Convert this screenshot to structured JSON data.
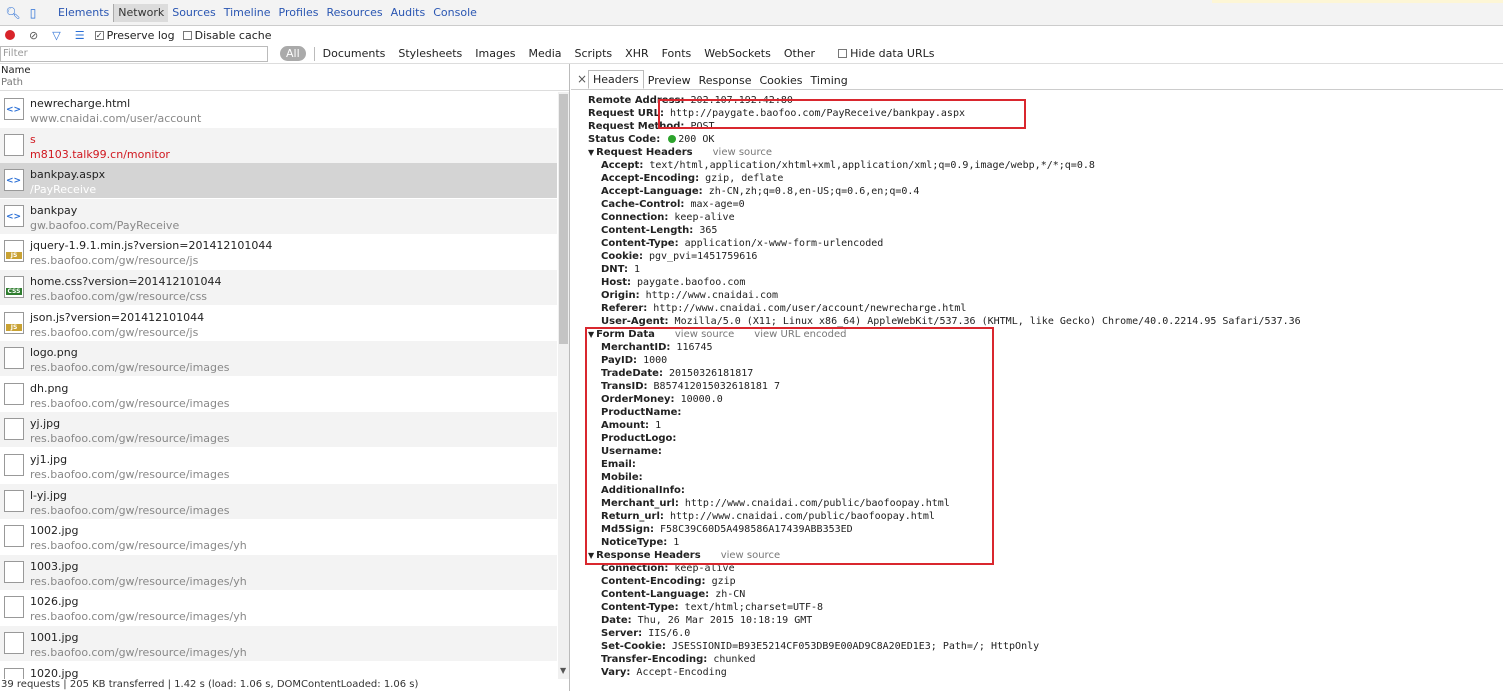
{
  "toolbar": {
    "tabs": [
      "Elements",
      "Network",
      "Sources",
      "Timeline",
      "Profiles",
      "Resources",
      "Audits",
      "Console"
    ]
  },
  "controls": {
    "preserve_log": "Preserve log",
    "disable_cache": "Disable cache"
  },
  "filter": {
    "placeholder": "Filter",
    "all": "All",
    "types": [
      "Documents",
      "Stylesheets",
      "Images",
      "Media",
      "Scripts",
      "XHR",
      "Fonts",
      "WebSockets",
      "Other"
    ],
    "hide_data_urls": "Hide data URLs"
  },
  "list": {
    "header_name": "Name",
    "header_path": "Path",
    "rows": [
      {
        "name": "newrecharge.html",
        "path": "www.cnaidai.com/user/account",
        "icon": "doc-icon"
      },
      {
        "name": "s",
        "path": "m8103.talk99.cn/monitor",
        "icon": "blank-icon"
      },
      {
        "name": "bankpay.aspx",
        "path": "/PayReceive",
        "icon": "doc-icon"
      },
      {
        "name": "bankpay",
        "path": "gw.baofoo.com/PayReceive",
        "icon": "doc-icon"
      },
      {
        "name": "jquery-1.9.1.min.js?version=201412101044",
        "path": "res.baofoo.com/gw/resource/js",
        "icon": "js-icon"
      },
      {
        "name": "home.css?version=201412101044",
        "path": "res.baofoo.com/gw/resource/css",
        "icon": "css-icon"
      },
      {
        "name": "json.js?version=201412101044",
        "path": "res.baofoo.com/gw/resource/js",
        "icon": "js-icon"
      },
      {
        "name": "logo.png",
        "path": "res.baofoo.com/gw/resource/images",
        "icon": "image-icon"
      },
      {
        "name": "dh.png",
        "path": "res.baofoo.com/gw/resource/images",
        "icon": "image-icon"
      },
      {
        "name": "yj.jpg",
        "path": "res.baofoo.com/gw/resource/images",
        "icon": "image-icon"
      },
      {
        "name": "yj1.jpg",
        "path": "res.baofoo.com/gw/resource/images",
        "icon": "image-icon"
      },
      {
        "name": "l-yj.jpg",
        "path": "res.baofoo.com/gw/resource/images",
        "icon": "image-icon"
      },
      {
        "name": "1002.jpg",
        "path": "res.baofoo.com/gw/resource/images/yh",
        "icon": "image-icon"
      },
      {
        "name": "1003.jpg",
        "path": "res.baofoo.com/gw/resource/images/yh",
        "icon": "image-icon"
      },
      {
        "name": "1026.jpg",
        "path": "res.baofoo.com/gw/resource/images/yh",
        "icon": "image-icon"
      },
      {
        "name": "1001.jpg",
        "path": "res.baofoo.com/gw/resource/images/yh",
        "icon": "image-icon"
      },
      {
        "name": "1020.jpg",
        "path": "",
        "icon": "image-icon"
      }
    ],
    "status": "39 requests | 205 KB transferred | 1.42 s (load: 1.06 s, DOMContentLoaded: 1.06 s)"
  },
  "detail": {
    "tabs": [
      "Headers",
      "Preview",
      "Response",
      "Cookies",
      "Timing"
    ],
    "general": [
      {
        "k": "Remote Address:",
        "v": "202.107.192.42:80"
      },
      {
        "k": "Request URL:",
        "v": "http://paygate.baofoo.com/PayReceive/bankpay.aspx"
      },
      {
        "k": "Request Method:",
        "v": "POST"
      },
      {
        "k": "Status Code:",
        "v": "200 OK"
      }
    ],
    "request_headers_title": "Request Headers",
    "view_source": "view source",
    "view_url_encoded": "view URL encoded",
    "request_headers": [
      {
        "k": "Accept:",
        "v": "text/html,application/xhtml+xml,application/xml;q=0.9,image/webp,*/*;q=0.8"
      },
      {
        "k": "Accept-Encoding:",
        "v": "gzip, deflate"
      },
      {
        "k": "Accept-Language:",
        "v": "zh-CN,zh;q=0.8,en-US;q=0.6,en;q=0.4"
      },
      {
        "k": "Cache-Control:",
        "v": "max-age=0"
      },
      {
        "k": "Connection:",
        "v": "keep-alive"
      },
      {
        "k": "Content-Length:",
        "v": "365"
      },
      {
        "k": "Content-Type:",
        "v": "application/x-www-form-urlencoded"
      },
      {
        "k": "Cookie:",
        "v": "pgv_pvi=1451759616"
      },
      {
        "k": "DNT:",
        "v": "1"
      },
      {
        "k": "Host:",
        "v": "paygate.baofoo.com"
      },
      {
        "k": "Origin:",
        "v": "http://www.cnaidai.com"
      },
      {
        "k": "Referer:",
        "v": "http://www.cnaidai.com/user/account/newrecharge.html"
      },
      {
        "k": "User-Agent:",
        "v": "Mozilla/5.0 (X11; Linux x86_64) AppleWebKit/537.36 (KHTML, like Gecko) Chrome/40.0.2214.95 Safari/537.36"
      }
    ],
    "form_data_title": "Form Data",
    "form_data": [
      {
        "k": "MerchantID:",
        "v": "116745"
      },
      {
        "k": "PayID:",
        "v": "1000"
      },
      {
        "k": "TradeDate:",
        "v": "20150326181817"
      },
      {
        "k": "TransID:",
        "v": "B857412015032618181 7"
      },
      {
        "k": "OrderMoney:",
        "v": "10000.0"
      },
      {
        "k": "ProductName:",
        "v": ""
      },
      {
        "k": "Amount:",
        "v": "1"
      },
      {
        "k": "ProductLogo:",
        "v": ""
      },
      {
        "k": "Username:",
        "v": ""
      },
      {
        "k": "Email:",
        "v": ""
      },
      {
        "k": "Mobile:",
        "v": ""
      },
      {
        "k": "AdditionalInfo:",
        "v": ""
      },
      {
        "k": "Merchant_url:",
        "v": "http://www.cnaidai.com/public/baofoopay.html"
      },
      {
        "k": "Return_url:",
        "v": "http://www.cnaidai.com/public/baofoopay.html"
      },
      {
        "k": "Md5Sign:",
        "v": "F58C39C60D5A498586A17439ABB353ED"
      },
      {
        "k": "NoticeType:",
        "v": "1"
      }
    ],
    "response_headers_title": "Response Headers",
    "response_headers": [
      {
        "k": "Connection:",
        "v": "keep-alive"
      },
      {
        "k": "Content-Encoding:",
        "v": "gzip"
      },
      {
        "k": "Content-Language:",
        "v": "zh-CN"
      },
      {
        "k": "Content-Type:",
        "v": "text/html;charset=UTF-8"
      },
      {
        "k": "Date:",
        "v": "Thu, 26 Mar 2015 10:18:19 GMT"
      },
      {
        "k": "Server:",
        "v": "IIS/6.0"
      },
      {
        "k": "Set-Cookie:",
        "v": "JSESSIONID=B93E5214CF053DB9E00AD9C8A20ED1E3; Path=/; HttpOnly"
      },
      {
        "k": "Transfer-Encoding:",
        "v": "chunked"
      },
      {
        "k": "Vary:",
        "v": "Accept-Encoding"
      }
    ]
  }
}
